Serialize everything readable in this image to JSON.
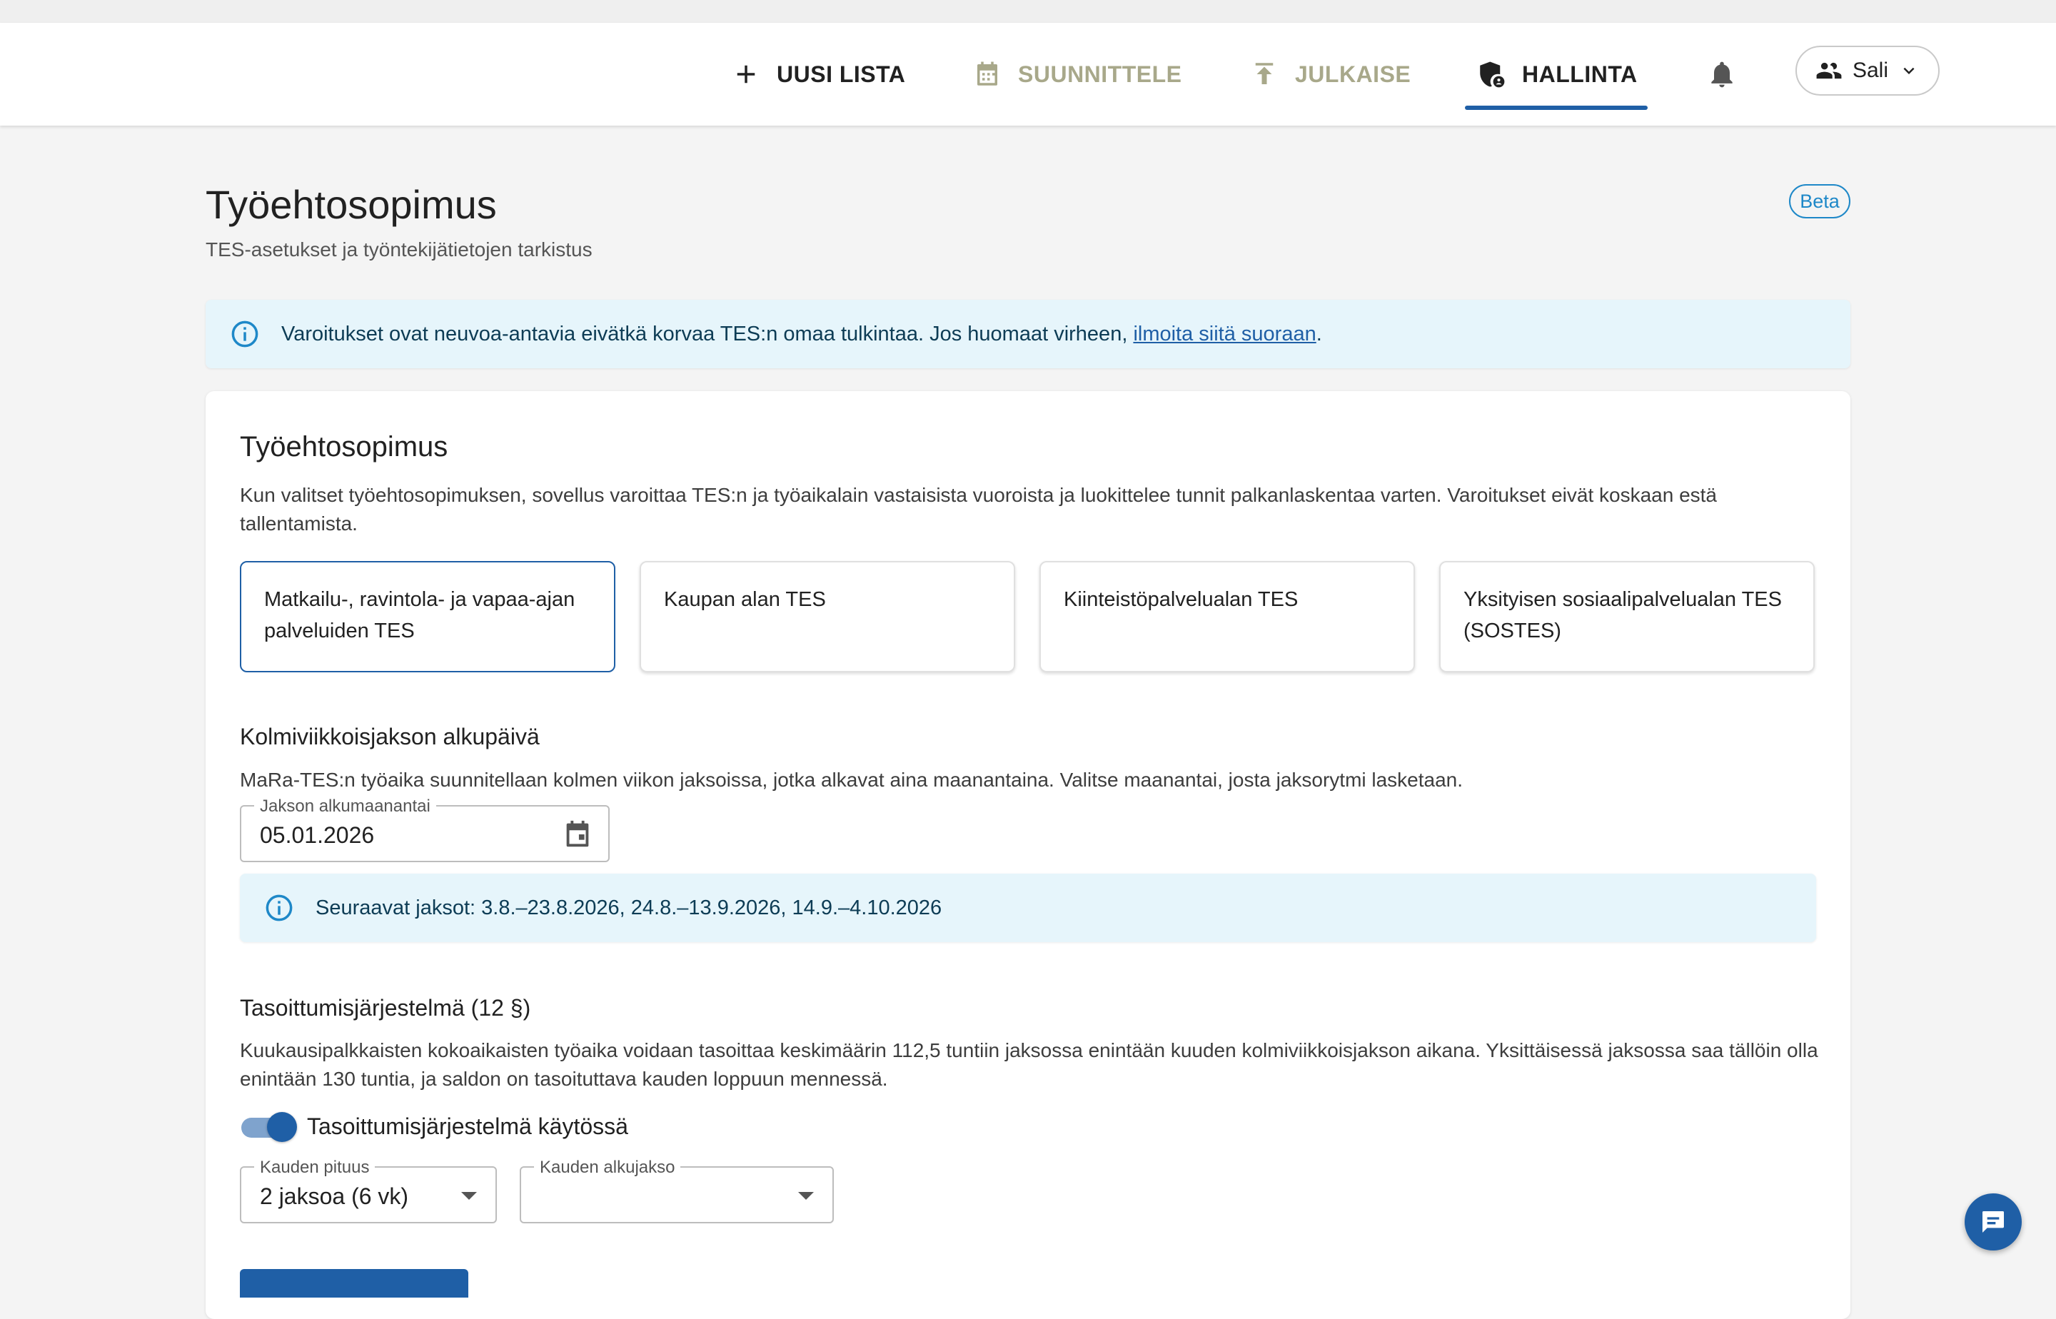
{
  "nav": {
    "new_list": "UUSI LISTA",
    "plan": "SUUNNITTELE",
    "publish": "JULKAISE",
    "admin": "HALLINTA",
    "active": "HALLINTA",
    "icons": [
      "plus-icon",
      "calendar-icon",
      "upload-icon",
      "admin-shield-icon",
      "bell-icon"
    ]
  },
  "user_menu": {
    "label": "Sali",
    "icon": "group-icon"
  },
  "page": {
    "title": "Työehtosopimus",
    "subtitle": "TES-asetukset ja työntekijätietojen tarkistus",
    "badge": "Beta"
  },
  "notice": {
    "text": "Varoitukset ovat neuvoa-antavia eivätkä korvaa TES:n omaa tulkintaa. Jos huomaat virheen, ",
    "link": "ilmoita siitä suoraan",
    "suffix": "."
  },
  "card": {
    "title": "Työehtosopimus",
    "description": "Kun valitset työehtosopimuksen, sovellus varoittaa TES:n ja työaikalain vastaisista vuoroista ja luokittelee tunnit palkanlaskentaa varten. Varoitukset eivät koskaan estä tallentamista.",
    "options": [
      {
        "label": "Matkailu-, ravintola- ja vapaa-ajan palveluiden TES",
        "selected": true
      },
      {
        "label": "Kaupan alan TES",
        "selected": false
      },
      {
        "label": "Kiinteistöpalvelualan TES",
        "selected": false
      },
      {
        "label": "Yksityisen sosiaalipalvelualan TES (SOSTES)",
        "selected": false
      }
    ]
  },
  "period": {
    "title": "Kolmiviikkoisjakson alkupäivä",
    "description": "MaRa-TES:n työaika suunnitellaan kolmen viikon jaksoissa, jotka alkavat aina maanantaina. Valitse maanantai, josta jaksorytmi lasketaan.",
    "field_label": "Jakson alkumaanantai",
    "field_value": "05.01.2026",
    "info": "Seuraavat jaksot: 3.8.–23.8.2026, 24.8.–13.9.2026, 14.9.–4.10.2026"
  },
  "balancing": {
    "title": "Tasoittumisjärjestelmä (12 §)",
    "description": "Kuukausipalkkaisten kokoaikaisten työaika voidaan tasoittaa keskimäärin 112,5 tuntiin jaksossa enintään kuuden kolmiviikkoisjakson aikana. Yksittäisessä jaksossa saa tällöin olla enintään 130 tuntia, ja saldon on tasoituttava kauden loppuun mennessä.",
    "toggle_label": "Tasoittumisjärjestelmä käytössä",
    "toggle_on": true,
    "season_length_label": "Kauden pituus",
    "season_length_value": "2 jaksoa (6 vk)",
    "season_start_label": "Kauden alkujakso",
    "season_start_value": ""
  },
  "colors": {
    "primary": "#1f5fa6",
    "info_bg": "#e6f5fb",
    "muted_nav": "#a8a88a"
  }
}
